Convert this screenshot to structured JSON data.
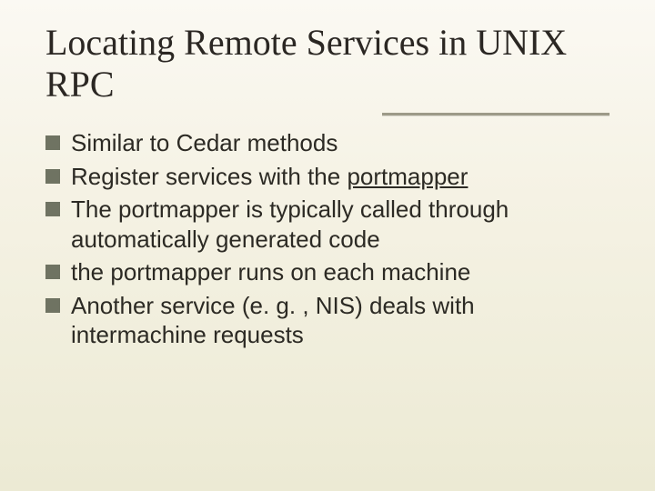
{
  "title": "Locating Remote Services in UNIX RPC",
  "bullets": [
    {
      "pre": "Similar to Cedar methods",
      "u": "",
      "post": ""
    },
    {
      "pre": "Register services with the ",
      "u": "portmapper",
      "post": ""
    },
    {
      "pre": "The portmapper is typically called through automatically generated code",
      "u": "",
      "post": ""
    },
    {
      "pre": "the portmapper runs on each machine",
      "u": "",
      "post": ""
    },
    {
      "pre": "Another service (e. g. , NIS) deals with intermachine requests",
      "u": "",
      "post": ""
    }
  ]
}
